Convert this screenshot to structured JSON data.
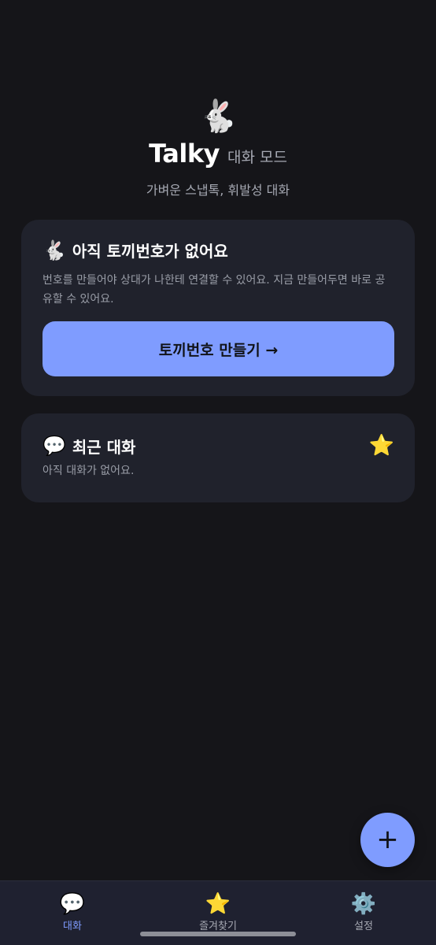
{
  "header": {
    "logo_icon": "🐇",
    "app_name": "Talky",
    "mode_label": "대화 모드",
    "subtitle": "가벼운 스냅톡, 휘발성 대화"
  },
  "empty_number_card": {
    "icon": "🐇",
    "title": "아직 토끼번호가 없어요",
    "description": "번호를 만들어야 상대가 나한테 연결할 수 있어요. 지금 만들어두면 바로 공유할 수 있어요.",
    "button_label": "토끼번호 만들기 →"
  },
  "recent_card": {
    "icon": "💬",
    "title": "최근 대화",
    "favorite_icon": "⭐",
    "empty_text": "아직 대화가 없어요."
  },
  "fab": {
    "label": "+"
  },
  "tabbar": {
    "items": [
      {
        "icon": "💬",
        "label": "대화",
        "active": true
      },
      {
        "icon": "⭐",
        "label": "즐겨찾기",
        "active": false
      },
      {
        "icon": "⚙️",
        "label": "설정",
        "active": false
      }
    ]
  },
  "colors": {
    "background": "#151519",
    "card": "#20222c",
    "accent": "#7f9cff",
    "muted_text": "#9a9ea8"
  }
}
